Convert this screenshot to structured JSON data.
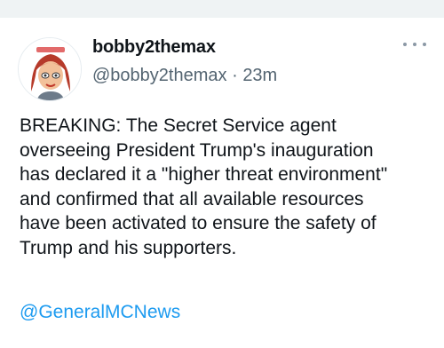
{
  "tweet": {
    "author": {
      "display_name": "bobby2themax",
      "handle": "@bobby2themax",
      "avatar_icon": "cartoon-avatar-red-hair-icon"
    },
    "separator": "·",
    "time_ago": "23m",
    "more_icon": "more-horizontal-icon",
    "text": "BREAKING: The Secret Service agent\noverseeing President Trump's inauguration\nhas declared it a \"higher threat environment\"\nand confirmed that all available resources\nhave been activated to ensure the safety of\nTrump and his supporters.",
    "mention": "@GeneralMCNews"
  },
  "colors": {
    "text": "#0f1419",
    "secondary": "#536471",
    "link": "#1d9bf0",
    "divider": "#eff3f4"
  }
}
